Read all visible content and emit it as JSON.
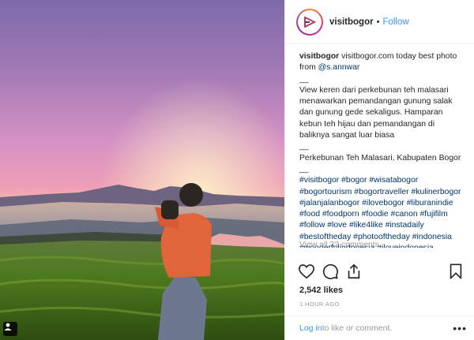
{
  "post": {
    "username": "visitbogor",
    "follow_label": "Follow",
    "header_separator": "•",
    "caption": {
      "username": "visitbogor",
      "lead_text": " visitbogor.com today best photo from ",
      "mention": "@s.annwar",
      "separator_1": "__",
      "description": "View keren dari perkebunan teh malasari menawarkan pemandangan gunung salak dan gunung gede sekaligus. Hamparan kebun teh hijau dan pemandangan di baliknya sangat luar biasa",
      "separator_2": "__",
      "location": "Perkebunan Teh Malasari, Kabupaten Bogor",
      "separator_3": "__",
      "hashtags": "#visitbogor #bogor #wisatabogor #bogortourism #bogortraveller #kulinerbogor #jalanjalanbogor #ilovebogor #liburanindie #food #foodporn #foodie #canon #fujifilm #follow #love #like4like #instadaily #bestoftheday #photooftheday #indonesia #wonderfulindonesia #iloveindonesia"
    },
    "view_all_comments": "View all 32 comments",
    "likes": "2,542 likes",
    "timestamp": "1 HOUR AGO",
    "comment_prompt": {
      "login_label": "Log in",
      "rest": " to like or comment.",
      "more": "•••"
    }
  },
  "icons": {
    "like": "heart-icon",
    "comment": "comment-icon",
    "share": "share-icon",
    "save": "bookmark-icon",
    "user_tag": "user-tag-icon",
    "avatar": "visitbogor-logo"
  },
  "colors": {
    "link_blue": "#3897f0",
    "hashtag_blue": "#003569",
    "muted": "#999999"
  }
}
